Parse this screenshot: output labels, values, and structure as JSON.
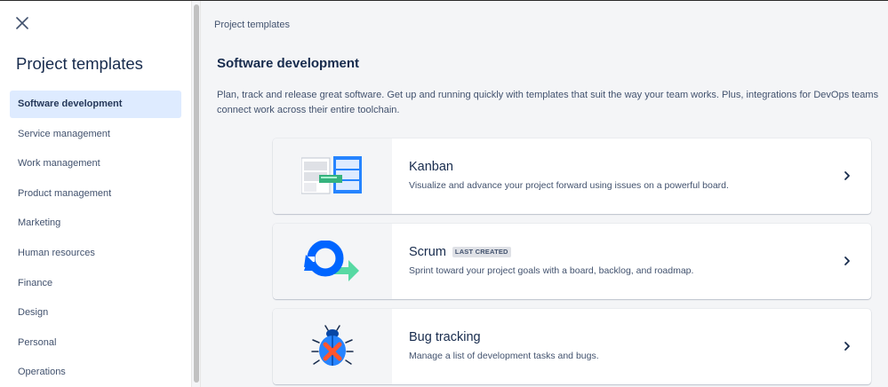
{
  "sidebar": {
    "title": "Project templates",
    "items": [
      {
        "label": "Software development",
        "active": true
      },
      {
        "label": "Service management"
      },
      {
        "label": "Work management"
      },
      {
        "label": "Product management"
      },
      {
        "label": "Marketing"
      },
      {
        "label": "Human resources"
      },
      {
        "label": "Finance"
      },
      {
        "label": "Design"
      },
      {
        "label": "Personal"
      },
      {
        "label": "Operations"
      }
    ]
  },
  "main": {
    "breadcrumb": "Project templates",
    "section_title": "Software development",
    "description_line1": "Plan, track and release great software. Get up and running quickly with templates that suit the way your team works. Plus, integrations for DevOps teams",
    "description_line2": "connect work across their entire toolchain.",
    "templates": [
      {
        "title": "Kanban",
        "description": "Visualize and advance your project forward using issues on a powerful board.",
        "icon": "kanban-board-illustration"
      },
      {
        "title": "Scrum",
        "badge": "LAST CREATED",
        "description": "Sprint toward your project goals with a board, backlog, and roadmap.",
        "icon": "scrum-cycle-illustration"
      },
      {
        "title": "Bug tracking",
        "description": "Manage a list of development tasks and bugs.",
        "icon": "bug-illustration"
      }
    ]
  },
  "colors": {
    "active_bg": "#deebff",
    "main_bg": "#f4f5f7",
    "brand_blue": "#0065ff",
    "text_primary": "#172b4d",
    "text_secondary": "#42526e"
  }
}
